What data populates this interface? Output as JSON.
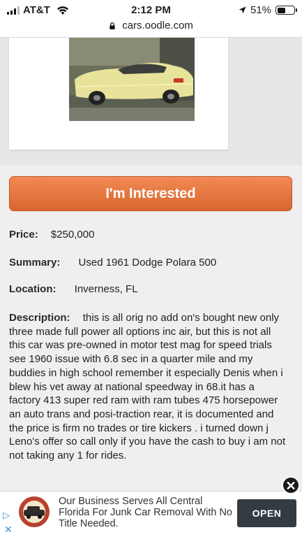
{
  "status_bar": {
    "carrier": "AT&T",
    "time": "2:12 PM",
    "battery_percent": "51%",
    "battery_level": 0.51
  },
  "browser": {
    "url": "cars.oodle.com"
  },
  "listing": {
    "interested_label": "I'm Interested",
    "price_label": "Price:",
    "price": "$250,000",
    "summary_label": "Summary:",
    "summary": "Used 1961 Dodge Polara 500",
    "location_label": "Location:",
    "location": "Inverness, FL",
    "description_label": "Description:",
    "description": "this is all orig no add on's bought new only three made full power all options inc air, but this is not all this car was pre-owned in motor test mag for speed trials see 1960 issue with 6.8 sec in a quarter mile and my buddies in high school remember it especially Denis when i blew his vet away at national speedway in 68.it has a factory 413 super red ram with ram tubes 475 horsepower an auto trans and posi-traction rear, it is documented and the price is firm no trades or tire kickers . i turned down j Leno's offer so call only if you have the cash to buy i am not not taking any 1 for rides."
  },
  "ad": {
    "text": "Our Business Serves All Central Florida For Junk Car Removal With No Title Needed.",
    "open_label": "OPEN",
    "close_glyph": "✕",
    "choices_glyph": "▷",
    "x_glyph": "✕"
  },
  "colors": {
    "button": "#e07340",
    "ad_button": "#333c43"
  }
}
